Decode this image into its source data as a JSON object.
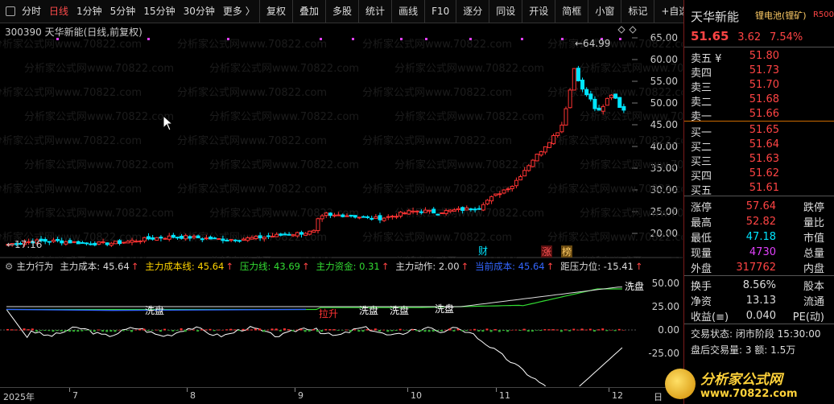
{
  "toolbar": {
    "left_items": [
      "分时",
      "日线",
      "1分钟",
      "5分钟",
      "15分钟",
      "30分钟",
      "更多 〉"
    ],
    "right_items": [
      "复权",
      "叠加",
      "多股",
      "统计",
      "画线",
      "F10",
      "逐分",
      "同设",
      "开设",
      "简框",
      "小窗",
      "标记",
      "+自选",
      "返回"
    ]
  },
  "stock": {
    "code_title": "300390 天华新能(日线,前复权)",
    "name": "天华新能",
    "tag": "锂电池(锂矿)",
    "badge": "R500",
    "price": "51.65",
    "change": "3.62",
    "change_pct": "7.54%"
  },
  "orderbook": {
    "sell": [
      [
        "卖五 ¥",
        "51.80"
      ],
      [
        "卖四",
        "51.73"
      ],
      [
        "卖三",
        "51.70"
      ],
      [
        "卖二",
        "51.68"
      ],
      [
        "卖一",
        "51.66"
      ]
    ],
    "buy": [
      [
        "买一",
        "51.65"
      ],
      [
        "买二",
        "51.64"
      ],
      [
        "买三",
        "51.63"
      ],
      [
        "买四",
        "51.62"
      ],
      [
        "买五",
        "51.61"
      ]
    ]
  },
  "stats": [
    {
      "k": "涨停",
      "v": "57.64",
      "vc": "#ff4444",
      "k2": "跌停"
    },
    {
      "k": "最高",
      "v": "52.82",
      "vc": "#ff4444",
      "k2": "量比"
    },
    {
      "k": "最低",
      "v": "47.18",
      "vc": "#00e5ff",
      "k2": "市值"
    },
    {
      "k": "现量",
      "v": "4730",
      "vc": "#e040fb",
      "k2": "总量"
    },
    {
      "k": "外盘",
      "v": "317762",
      "vc": "#ff4444",
      "k2": "内盘"
    }
  ],
  "stats2": [
    {
      "k": "换手",
      "v": "8.56%",
      "k2": "股本"
    },
    {
      "k": "净资",
      "v": "13.13",
      "k2": "流通"
    },
    {
      "k": "收益(≡)",
      "v": "0.040",
      "k2": "PE(动)"
    }
  ],
  "status": {
    "trade_state": "交易状态: 闭市阶段 15:30:00",
    "after_hours": "盘后交易量: 3  额: 1.5万"
  },
  "main_axis": [
    "65.00",
    "60.00",
    "55.00",
    "50.00",
    "45.00",
    "40.00",
    "35.00",
    "30.00",
    "25.00",
    "20.00"
  ],
  "annotations": {
    "high": "64.99",
    "low": "17.16",
    "cai": "财",
    "zhang": "涨",
    "bang": "榜"
  },
  "indicator": {
    "name": "主力行为",
    "items": [
      {
        "t": "主力成本: 45.64",
        "c": "#dddddd"
      },
      {
        "t": "主力成本线: 45.64",
        "c": "#ffd400"
      },
      {
        "t": "压力线: 43.69",
        "c": "#33dd33"
      },
      {
        "t": "主力资金: 0.31",
        "c": "#33dd33"
      },
      {
        "t": "主力动作: 2.00",
        "c": "#dddddd"
      },
      {
        "t": "当前成本: 45.64",
        "c": "#3366ff"
      },
      {
        "t": "距压力位: -15.41",
        "c": "#dddddd"
      }
    ],
    "labels": [
      "洗盘",
      "洗盘",
      "洗盘",
      "洗盘",
      "洗盘",
      "拉升"
    ],
    "axis": [
      "50.00",
      "25.00",
      "0.00",
      "-25.00"
    ]
  },
  "dates": [
    "2025年",
    "7",
    "8",
    "9",
    "10",
    "11",
    "12",
    "日"
  ],
  "logo": {
    "line1": "分析家公式网",
    "line2": "www.70822.com"
  },
  "watermark": "分析家公式网www.70822.com"
}
